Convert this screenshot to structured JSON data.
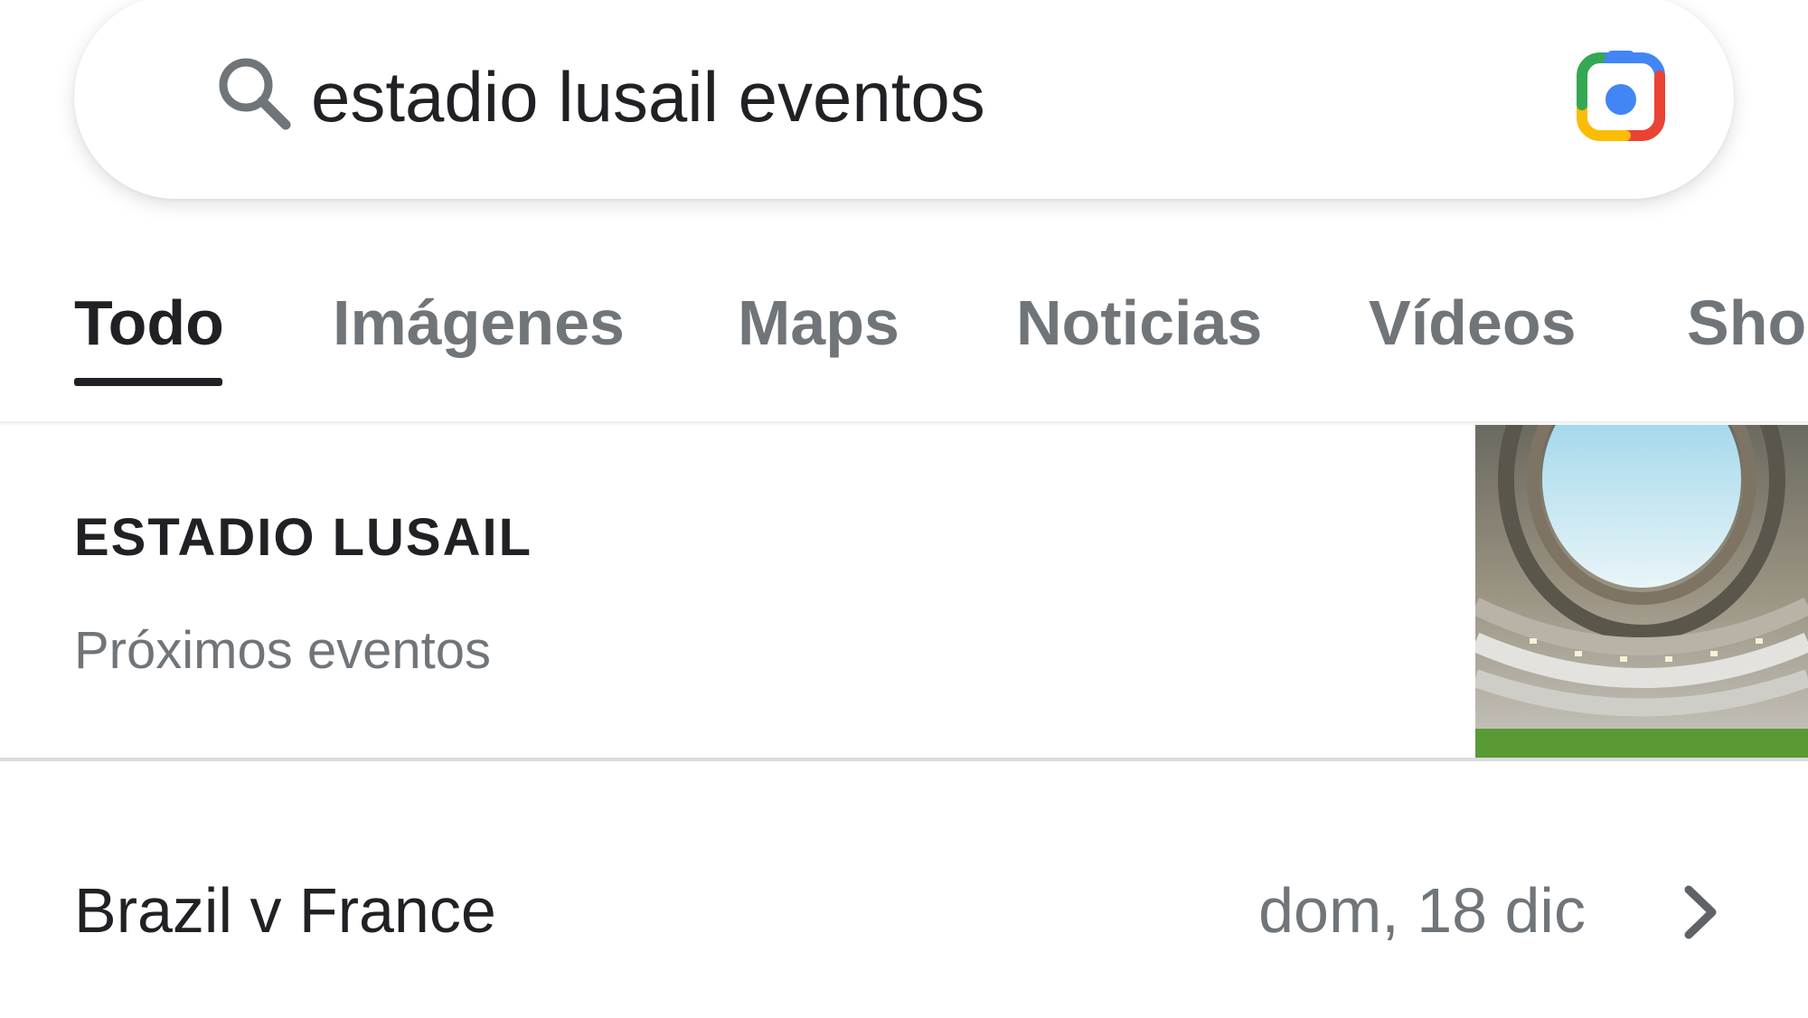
{
  "search": {
    "query": "estadio lusail eventos"
  },
  "tabs": [
    {
      "label": "Todo",
      "active": true
    },
    {
      "label": "Imágenes",
      "active": false
    },
    {
      "label": "Maps",
      "active": false
    },
    {
      "label": "Noticias",
      "active": false
    },
    {
      "label": "Vídeos",
      "active": false
    },
    {
      "label": "Sho",
      "active": false
    }
  ],
  "knowledge": {
    "title": "ESTADIO LUSAIL",
    "subtitle": "Próximos eventos"
  },
  "events": [
    {
      "name": "Brazil v France",
      "date": "dom, 18 dic"
    }
  ],
  "icons": {
    "search": "search-icon",
    "lens": "google-lens-icon",
    "chevron": "chevron-right-icon"
  },
  "colors": {
    "primary_text": "#202124",
    "secondary_text": "#70757a",
    "google_blue": "#4285f4",
    "google_red": "#ea4335",
    "google_yellow": "#fbbc04",
    "google_green": "#34a853"
  }
}
